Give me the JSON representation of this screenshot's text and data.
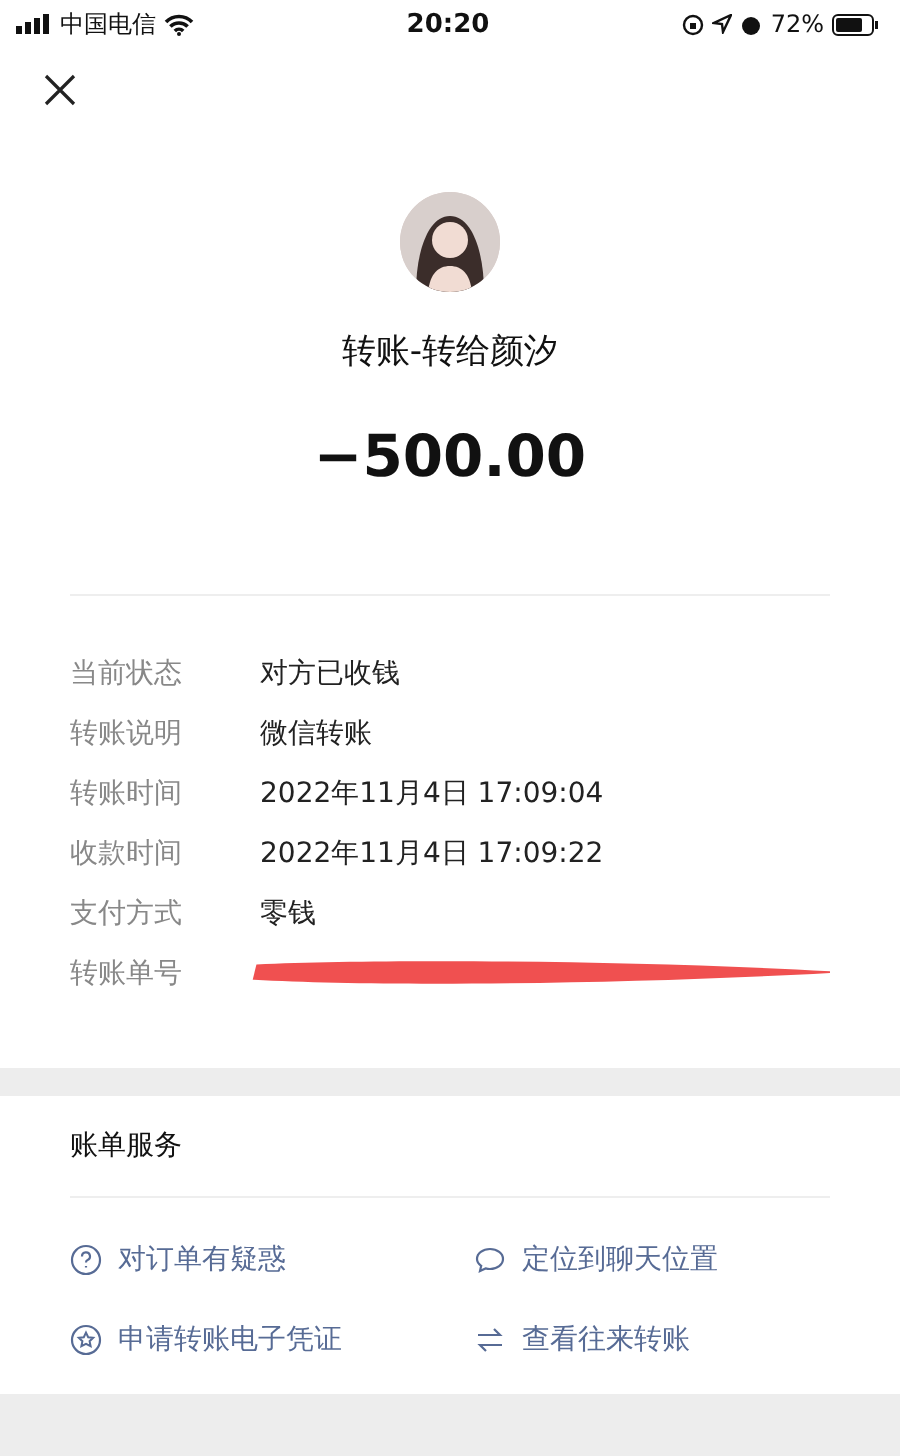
{
  "status_bar": {
    "carrier": "中国电信",
    "time": "20:20",
    "battery": "72%"
  },
  "header": {
    "title": "转账-转给颜汐",
    "amount": "−500.00"
  },
  "details": [
    {
      "label": "当前状态",
      "value": "对方已收钱",
      "kind": "text"
    },
    {
      "label": "转账说明",
      "value": "微信转账",
      "kind": "text"
    },
    {
      "label": "转账时间",
      "value": "2022年11月4日 17:09:04",
      "kind": "text"
    },
    {
      "label": "收款时间",
      "value": "2022年11月4日 17:09:22",
      "kind": "text"
    },
    {
      "label": "支付方式",
      "value": "零钱",
      "kind": "text"
    },
    {
      "label": "转账单号",
      "kind": "redacted"
    }
  ],
  "services": {
    "title": "账单服务",
    "items": [
      {
        "label": "对订单有疑惑",
        "kind": "question"
      },
      {
        "label": "定位到聊天位置",
        "kind": "chat"
      },
      {
        "label": "申请转账电子凭证",
        "kind": "star"
      },
      {
        "label": "查看往来转账",
        "kind": "swap"
      }
    ]
  }
}
